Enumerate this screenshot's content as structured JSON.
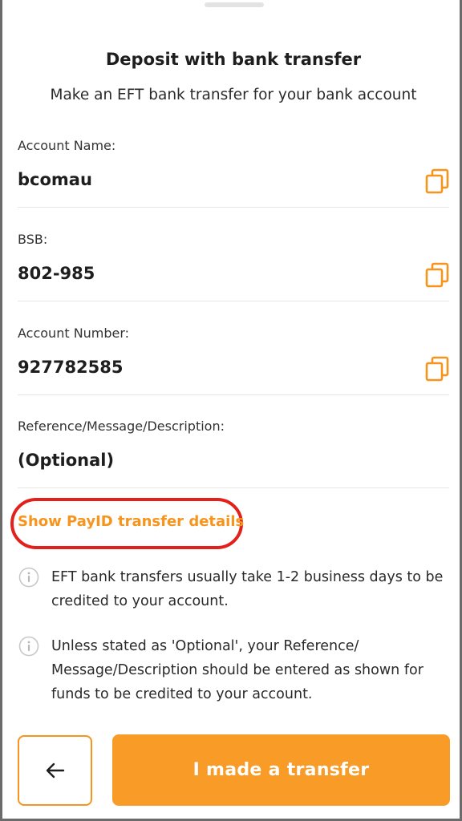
{
  "header": {
    "title": "Deposit with bank transfer",
    "subtitle": "Make an EFT bank transfer for your bank account"
  },
  "fields": [
    {
      "label": "Account Name:",
      "value": "bcomau",
      "copy_icon": "copy-icon"
    },
    {
      "label": "BSB:",
      "value": "802-985",
      "copy_icon": "copy-icon"
    },
    {
      "label": "Account Number:",
      "value": "927782585",
      "copy_icon": "copy-icon"
    },
    {
      "label": "Reference/Message/Description:",
      "value": "(Optional)"
    }
  ],
  "payid_link": "Show PayID transfer details",
  "info": [
    {
      "icon": "info-icon",
      "text": "EFT bank transfers usually take 1-2 business days to be credited to your account."
    },
    {
      "icon": "info-icon",
      "text": "Unless stated as 'Optional', your Reference/ Message/Description should be entered as shown for funds to be credited to your account."
    }
  ],
  "actions": {
    "back_icon": "arrow-left-icon",
    "primary_label": "I made a transfer"
  },
  "colors": {
    "accent": "#f89c27",
    "link": "#f7941d",
    "highlight": "#e2211c"
  }
}
